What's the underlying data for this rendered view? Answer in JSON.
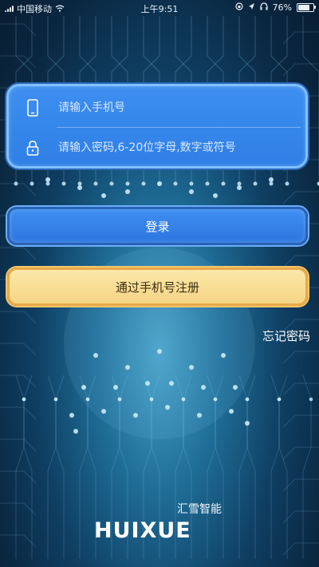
{
  "status_bar": {
    "carrier": "中国移动",
    "time": "上午9:51",
    "battery": "76%",
    "battery_level": 0.76
  },
  "login_form": {
    "phone_placeholder": "请输入手机号",
    "password_placeholder": "请输入密码,6-20位字母,数字或符号",
    "icons": [
      "phone-icon",
      "lock-icon"
    ]
  },
  "actions": {
    "login_label": "登录",
    "register_label": "通过手机号注册",
    "forgot_label": "忘记密码"
  },
  "brand": {
    "name_cn": "汇雪智能",
    "name_en": "HUIXUE"
  },
  "colors": {
    "primary_blue": "#2f7fe6",
    "register_yellow": "#f5d585",
    "register_border": "#e8a94a"
  }
}
